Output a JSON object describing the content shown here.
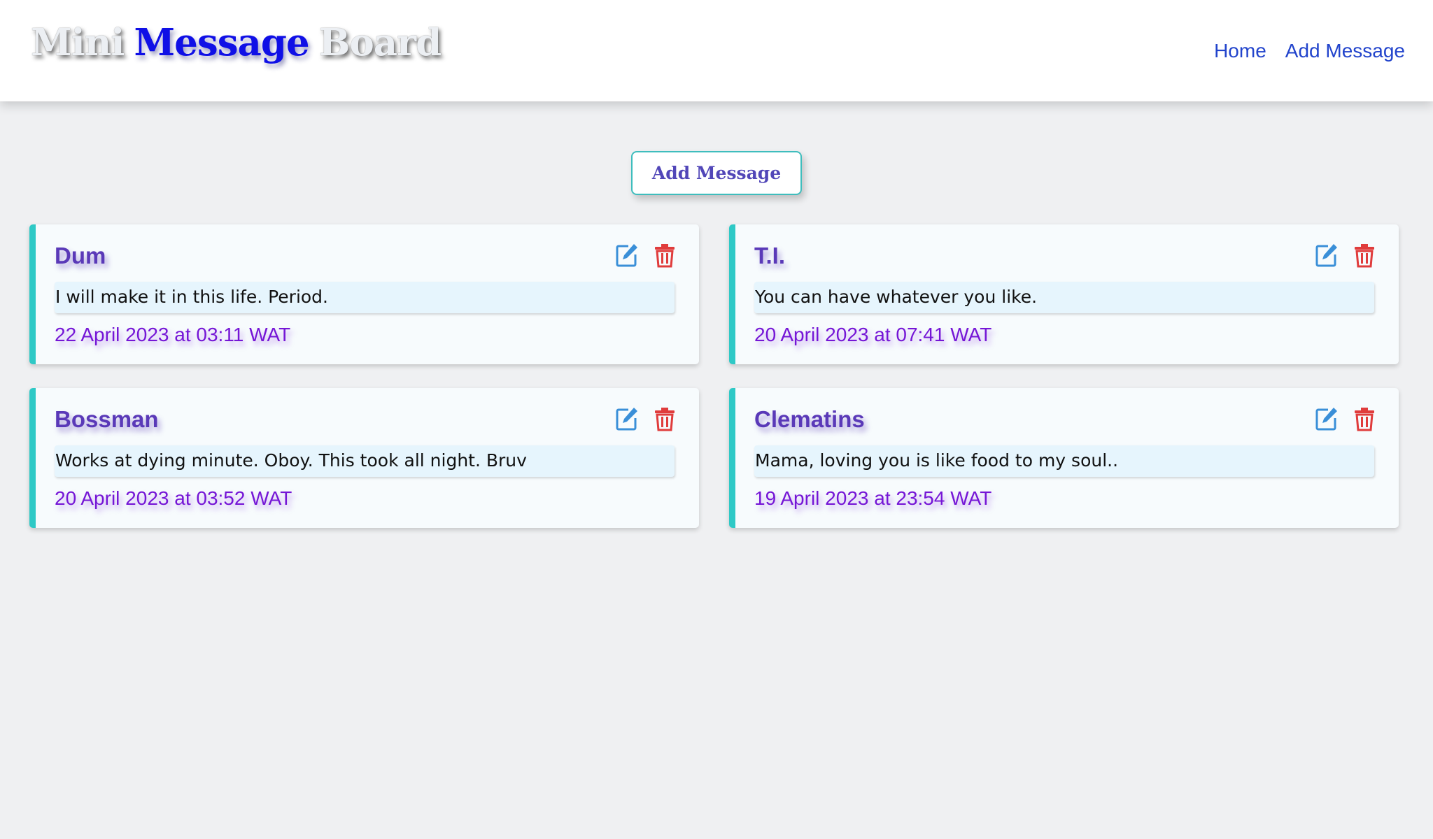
{
  "header": {
    "title_words": [
      "Mini",
      "Message",
      "Board"
    ],
    "nav": [
      {
        "label": "Home"
      },
      {
        "label": "Add Message"
      }
    ]
  },
  "main": {
    "add_button_label": "Add Message",
    "messages": [
      {
        "author": "Dum",
        "text": "I will make it in this life. Period.",
        "date": "22 April 2023 at 03:11 WAT"
      },
      {
        "author": "T.I.",
        "text": "You can have whatever you like.",
        "date": "20 April 2023 at 07:41 WAT"
      },
      {
        "author": "Bossman",
        "text": "Works at dying minute. Oboy. This took all night. Bruv",
        "date": "20 April 2023 at 03:52 WAT"
      },
      {
        "author": "Clematins",
        "text": "Mama, loving you is like food to my soul..",
        "date": "19 April 2023 at 23:54 WAT"
      }
    ],
    "icons": {
      "edit": "edit-icon",
      "delete": "trash-icon"
    }
  },
  "colors": {
    "accent_teal": "#2ec9c6",
    "author_purple": "#5a39b8",
    "date_purple": "#7516d6",
    "edit_blue": "#3a8fd8",
    "delete_red": "#e03c3c",
    "nav_blue": "#2244cc"
  }
}
